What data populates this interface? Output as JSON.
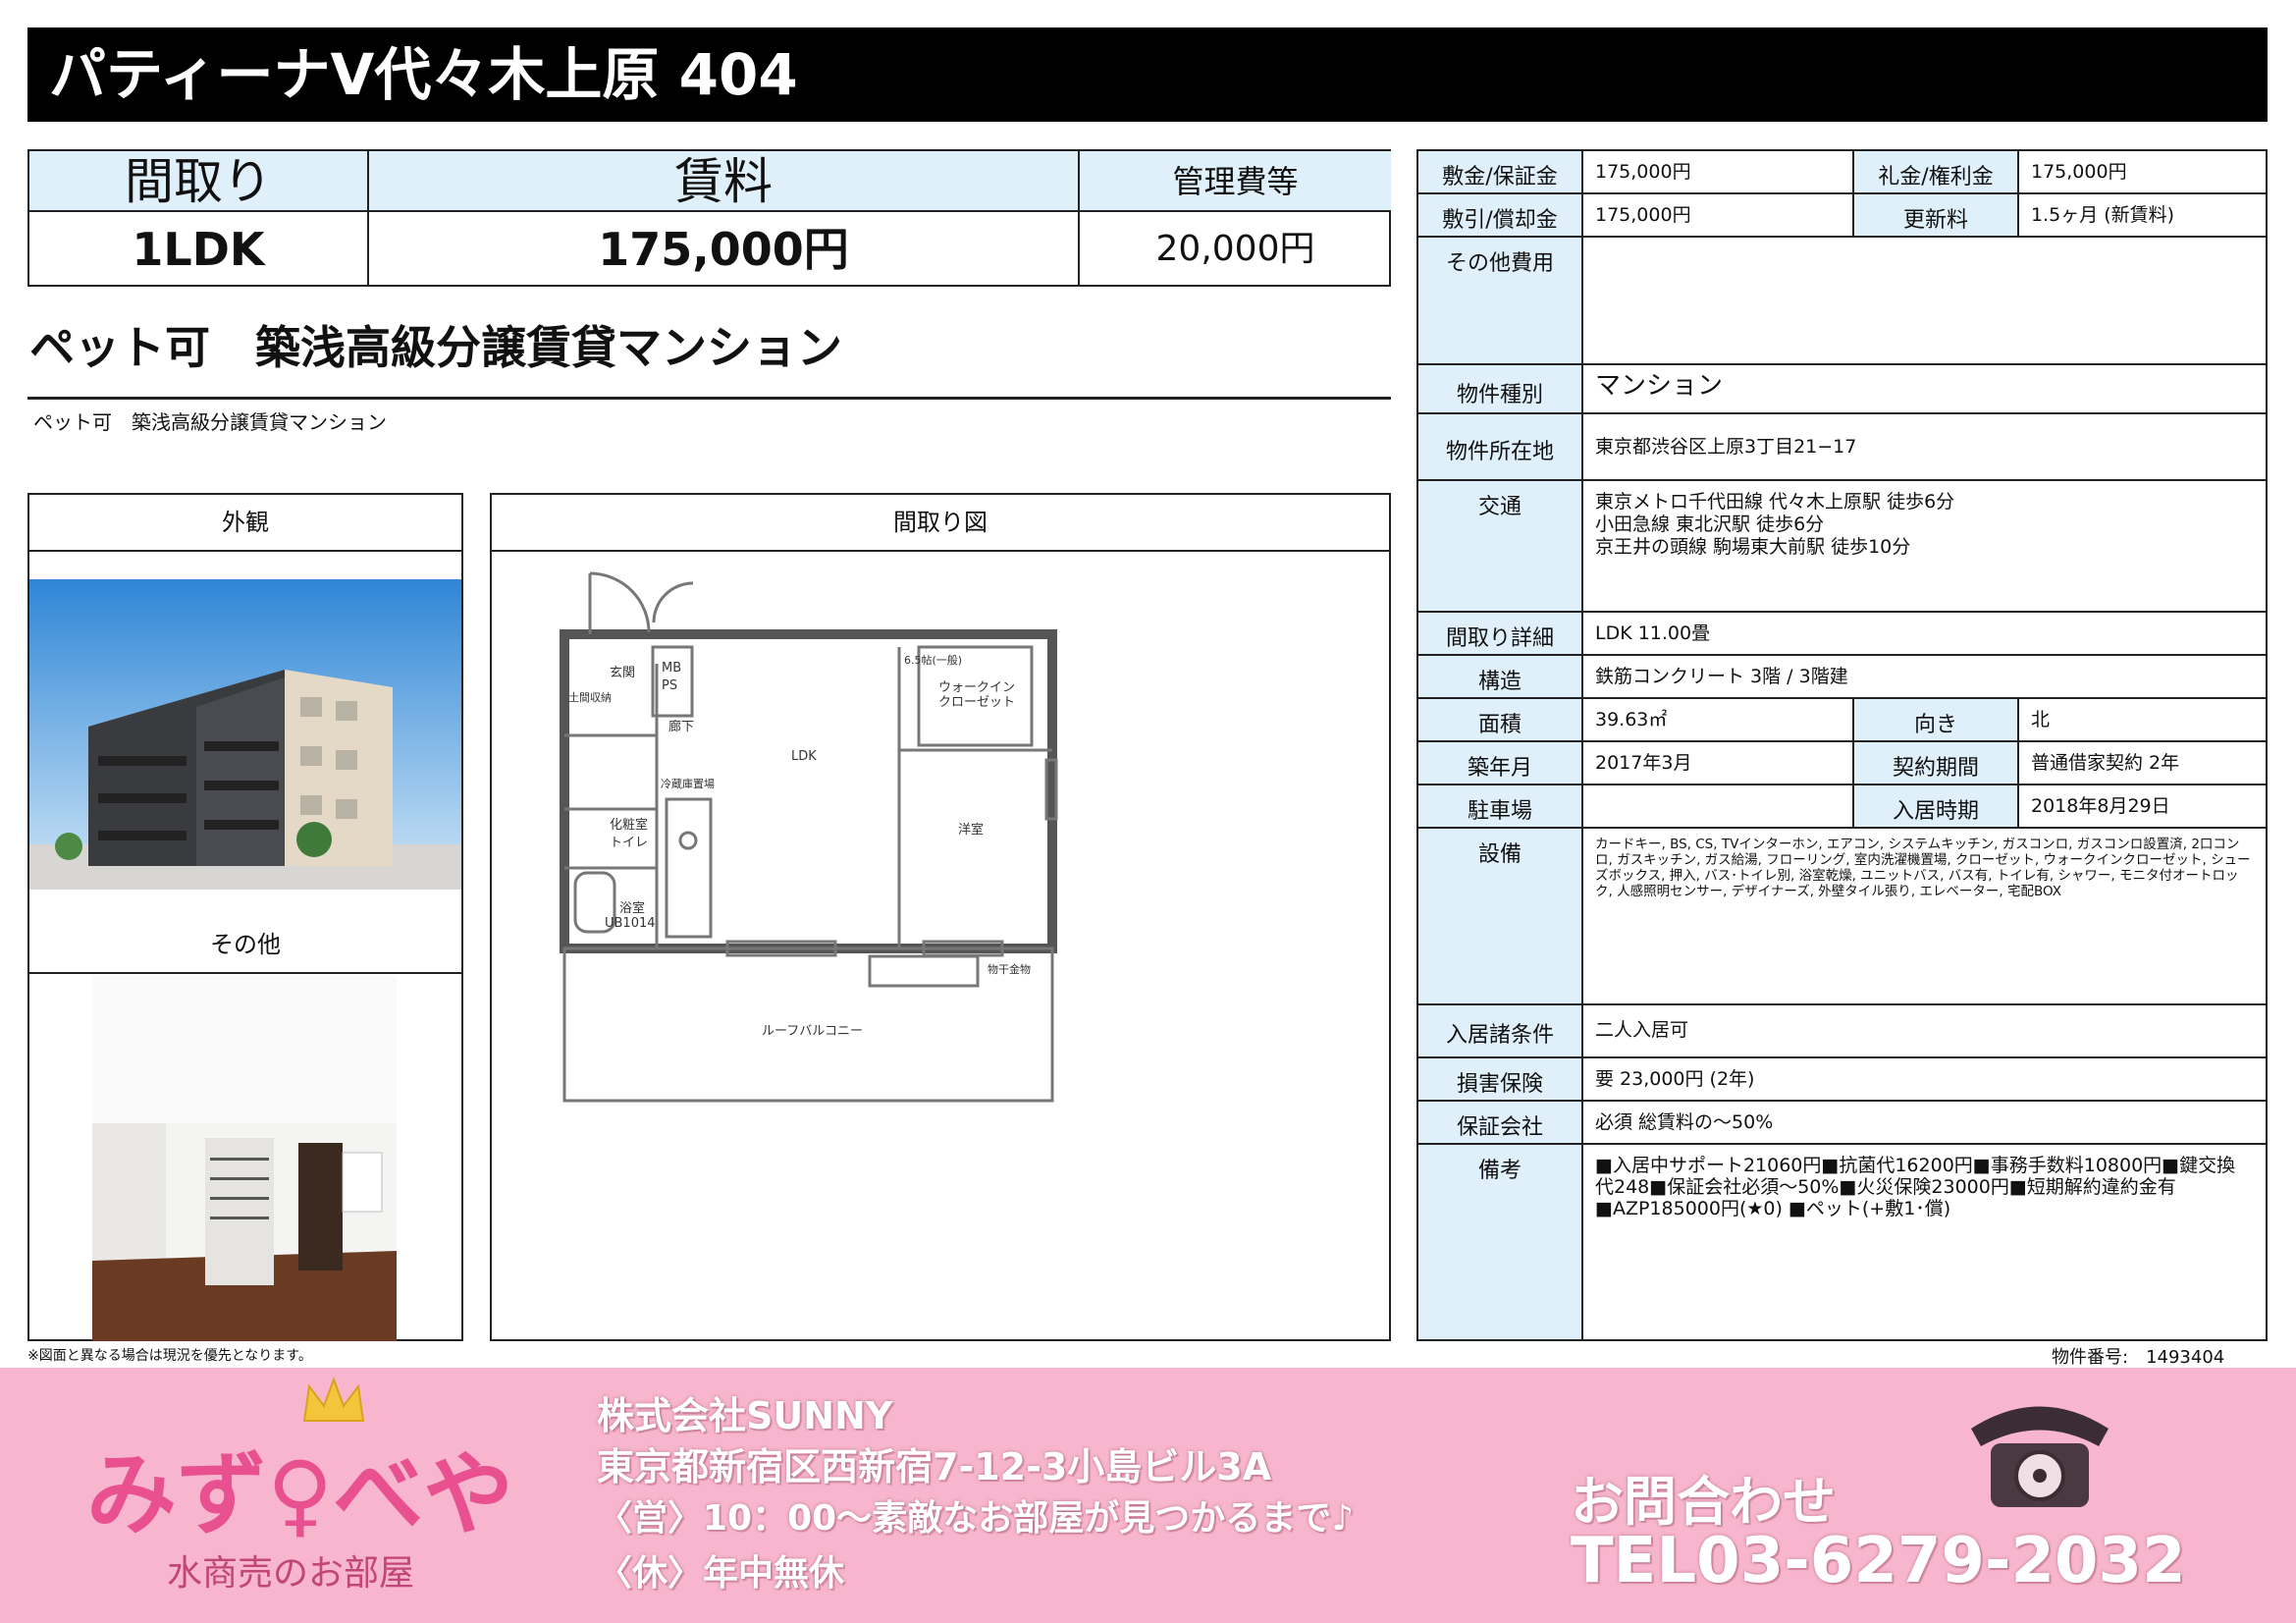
{
  "title": "パティーナⅤ代々木上原 404",
  "summary": {
    "headers": [
      "間取り",
      "賃料",
      "管理費等"
    ],
    "values": [
      "1LDK",
      "175,000円",
      "20,000円"
    ]
  },
  "catch_copy": "ペット可　築浅高級分譲賃貸マンション",
  "sub_copy": "ペット可　築浅高級分譲賃貸マンション",
  "panels": {
    "exterior": "外観",
    "other": "その他",
    "floorplan": "間取り図"
  },
  "floorplan_labels": {
    "entrance": "玄関",
    "mbps1": "MB",
    "mbps2": "PS",
    "hall": "廊下",
    "ldk": "LDK",
    "walkin1": "ウォークイン",
    "walkin2": "クローゼット",
    "western": "洋室",
    "vanity": "化粧室",
    "toilet": "トイレ",
    "bath1": "浴室",
    "bath2": "UB1014",
    "fridge": "冷蔵庫置場",
    "bicycle": "土間収納",
    "storage": "6.5帖(一般)",
    "drying": "物干金物",
    "balcony": "ルーフバルコニー"
  },
  "info": {
    "deposit_label": "敷金/保証金",
    "deposit": "175,000円",
    "key_label": "礼金/権利金",
    "key": "175,000円",
    "shiki_label": "敷引/償却金",
    "shiki": "175,000円",
    "renewal_label": "更新料",
    "renewal": "1.5ヶ月 (新賃料)",
    "other_fee_label": "その他費用",
    "other_fee": "",
    "type_label": "物件種別",
    "type": "マンション",
    "address_label": "物件所在地",
    "address": "東京都渋谷区上原3丁目21−17",
    "transport_label": "交通",
    "transport": [
      "東京メトロ千代田線 代々木上原駅 徒歩6分",
      "小田急線 東北沢駅 徒歩6分",
      "京王井の頭線 駒場東大前駅 徒歩10分"
    ],
    "layout_label": "間取り詳細",
    "layout": "LDK 11.00畳",
    "structure_label": "構造",
    "structure": "鉄筋コンクリート 3階 / 3階建",
    "area_label": "面積",
    "area": "39.63㎡",
    "direction_label": "向き",
    "direction": "北",
    "built_label": "築年月",
    "built": "2017年3月",
    "contract_label": "契約期間",
    "contract": "普通借家契約 2年",
    "parking_label": "駐車場",
    "parking": "",
    "movein_label": "入居時期",
    "movein": "2018年8月29日",
    "equipment_label": "設備",
    "equipment": "カードキー, BS, CS, TVインターホン, エアコン, システムキッチン, ガスコンロ, ガスコンロ設置済, 2口コンロ, ガスキッチン, ガス給湯, フローリング, 室内洗濯機置場, クローゼット, ウォークインクローゼット, シューズボックス, 押入, バス･トイレ別, 浴室乾燥, ユニットバス, バス有, トイレ有, シャワー, モニタ付オートロック, 人感照明センサー, デザイナーズ, 外壁タイル張り, エレベーター, 宅配BOX",
    "conditions_label": "入居諸条件",
    "conditions": "二人入居可",
    "insurance_label": "損害保険",
    "insurance": "要 23,000円 (2年)",
    "guarantor_label": "保証会社",
    "guarantor": "必須 総賃料の〜50%",
    "remarks_label": "備考",
    "remarks": "■入居中サポート21060円■抗菌代16200円■事務手数料10800円■鍵交換代248■保証会社必須〜50%■火災保険23000円■短期解約違約金有■AZP185000円(★0) ■ペット(+敷1･償)"
  },
  "note": "※図面と異なる場合は現況を優先となります。",
  "property_number": "物件番号:　1493404",
  "footer": {
    "logo": "みず♀べや",
    "logo_sub": "水商売のお部屋",
    "company": "株式会社SUNNY",
    "address": "東京都新宿区西新宿7-12-3小島ビル3A",
    "hours": "〈営〉10：00〜素敵なお部屋が見つかるまで♪",
    "holiday": "〈休〉年中無休",
    "contact": "お問合わせ",
    "tel": "TEL03-6279-2032",
    "colors": {
      "background": "#f7b6cd",
      "logo_pink": "#e8508f",
      "crown": "#f3c53a"
    }
  }
}
